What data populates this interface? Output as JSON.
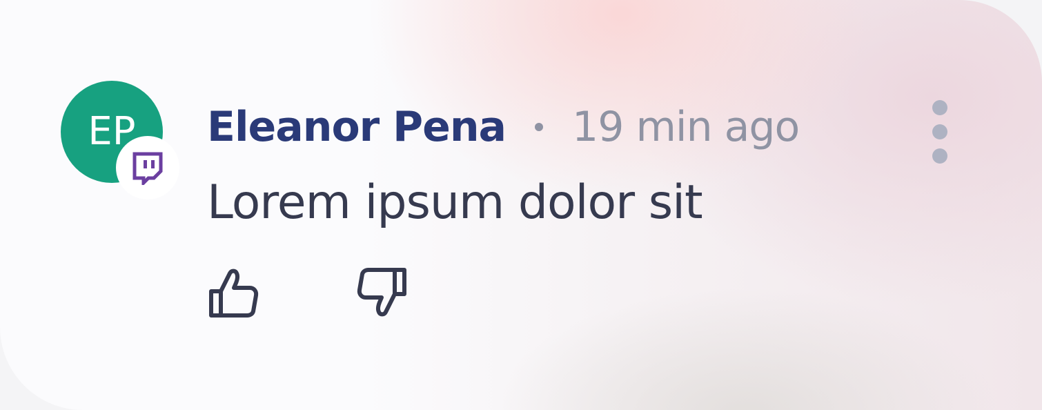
{
  "comment": {
    "avatar_initials": "EP",
    "author": "Eleanor Pena",
    "separator": "•",
    "timestamp": "19 min ago",
    "text": "Lorem ipsum dolor sit"
  },
  "icons": {
    "platform": "twitch-icon",
    "more": "more-vertical-icon",
    "like": "thumbs-up-icon",
    "dislike": "thumbs-down-icon"
  },
  "colors": {
    "avatar_bg": "#17a180",
    "author": "#2a3a78",
    "timestamp": "#8f93a3",
    "text": "#363a4f",
    "platform_brand": "#6b3fa0",
    "more_dots": "#aeb2c2"
  }
}
